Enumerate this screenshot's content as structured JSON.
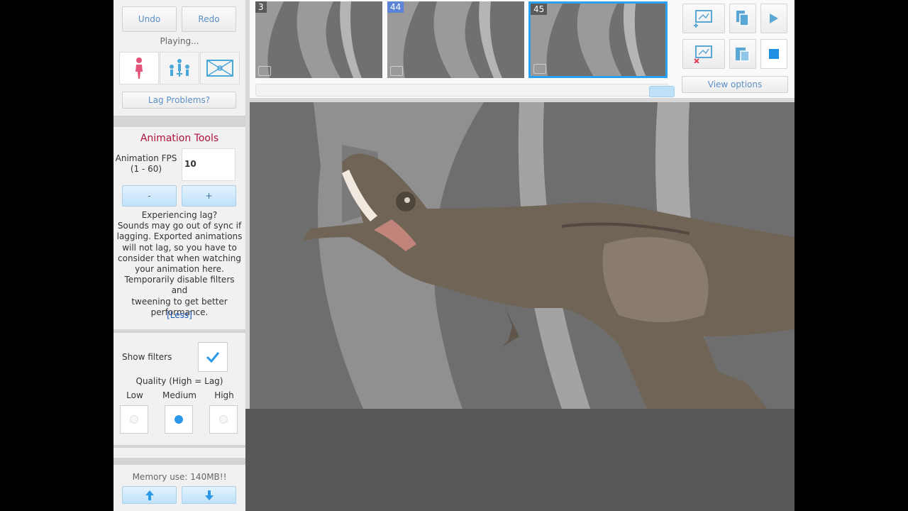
{
  "history": {
    "undo_label": "Undo",
    "redo_label": "Redo",
    "status": "Playing..."
  },
  "modes": [
    "single-figure-icon",
    "group-figures-icon",
    "scene-icon"
  ],
  "lag_button": "Lag Problems?",
  "animation_tools": {
    "title": "Animation Tools",
    "fps_label_1": "Animation FPS",
    "fps_label_2": "(1 - 60)",
    "fps_value": "10",
    "minus_label": "-",
    "plus_label": "+",
    "lag_info": [
      "Experiencing lag?",
      "Sounds may go out of sync if",
      "lagging. Exported animations",
      "will not lag, so you have to",
      "consider that when watching",
      "your animation here.",
      "Temporarily disable filters and",
      "tweening to get better",
      "performance."
    ],
    "less_link": "[Less]"
  },
  "filters": {
    "show_filters_label": "Show filters",
    "show_filters_checked": true,
    "quality_label": "Quality (High = Lag)",
    "options": [
      "Low",
      "Medium",
      "High"
    ],
    "selected": "Medium"
  },
  "memory": {
    "label": "Memory use: 140MB!!"
  },
  "timeline": {
    "frames": [
      {
        "number": "3",
        "highlighted": false,
        "selected": false
      },
      {
        "number": "44",
        "highlighted": true,
        "selected": false
      },
      {
        "number": "45",
        "highlighted": false,
        "selected": true
      }
    ],
    "view_options_label": "View options"
  },
  "colors": {
    "accent": "#2aa0f0",
    "title_red": "#b0103a",
    "link_blue": "#1a56b8"
  }
}
